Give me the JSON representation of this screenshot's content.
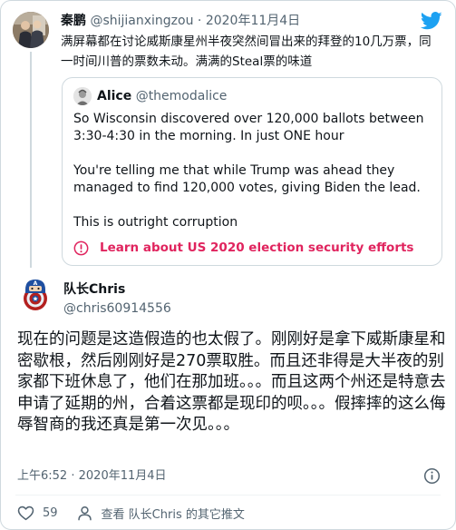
{
  "parent": {
    "name": "秦鹏",
    "handle": "@shijianxingzou",
    "separator": "·",
    "date": "2020年11月4日",
    "text": "满屏幕都在讨论威斯康星州半夜突然间冒出来的拜登的10几万票，同一时间川普的票数未动。满满的Steal票的味道"
  },
  "quote": {
    "name": "Alice",
    "handle": "@themodalice",
    "paragraphs": [
      "So Wisconsin discovered over 120,000 ballots between 3:30-4:30 in the morning. In just ONE hour",
      "You're telling me that while Trump was ahead they managed to find 120,000 votes, giving Biden the lead.",
      "This is outright corruption"
    ],
    "notice": "Learn about US 2020 election security efforts"
  },
  "tweet": {
    "name": "队长Chris",
    "handle": "@chris60914556",
    "text": "现在的问题是这造假造的也太假了。刚刚好是拿下威斯康星和密歇根，然后刚刚好是270票取胜。而且还非得是大半夜的别家都下班休息了，他们在那加班。。。而且这两个州还是特意去申请了延期的州，合着这票都是现印的呗。。。假摔摔的这么侮辱智商的我还真是第一次见。。。",
    "time": "上午6:52",
    "separator": "·",
    "date": "2020年11月4日",
    "likes": "59",
    "view_more": "查看 队长Chris 的其它推文"
  },
  "icons": {
    "brand": "twitter-bird-icon",
    "notice": "alert-circle-icon",
    "info": "info-icon",
    "like": "heart-icon",
    "profile": "person-icon"
  },
  "colors": {
    "brand": "#1da1f2",
    "notice": "#e0245e",
    "secondary_text": "#536471",
    "border": "#cfd9de"
  }
}
